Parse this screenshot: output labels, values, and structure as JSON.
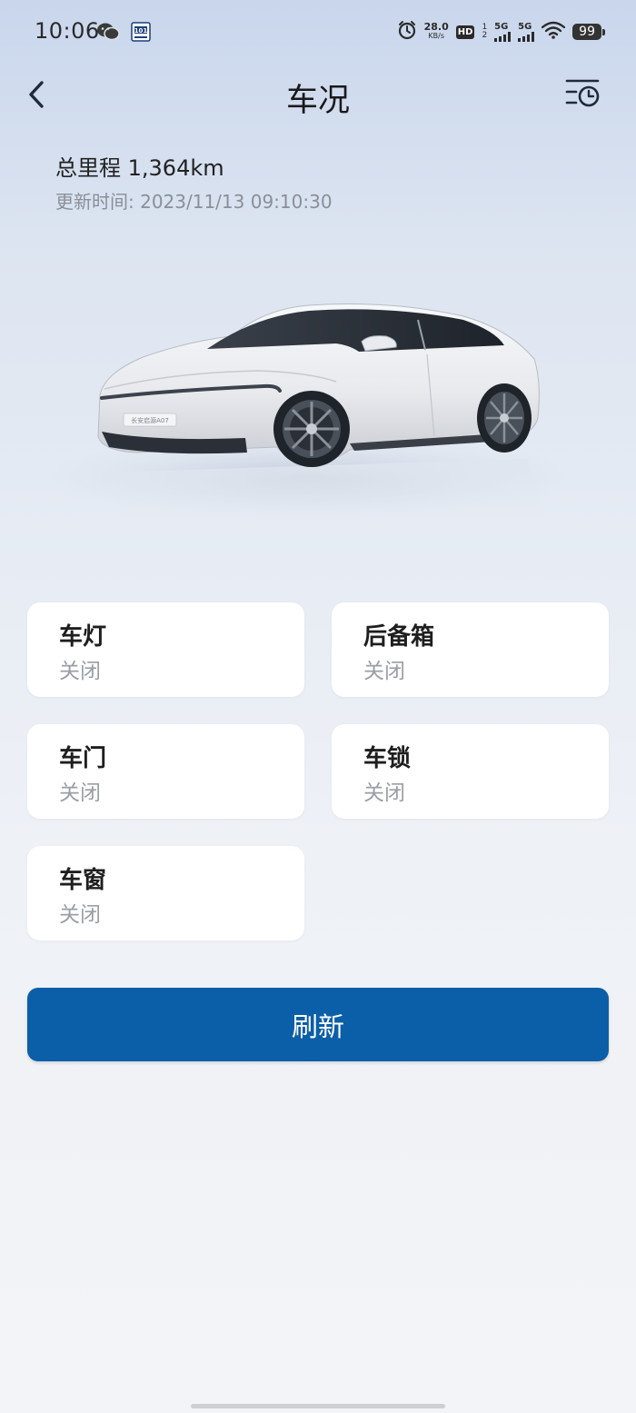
{
  "status_bar": {
    "time": "10:06",
    "net_speed_value": "28.0",
    "net_speed_unit": "KB/s",
    "hd_label": "HD",
    "sim_1": "1",
    "sim_2": "2",
    "signal_1_label": "5G",
    "signal_2_label": "5G",
    "battery": "99",
    "icons": [
      "wechat-icon",
      "app-notification-icon",
      "alarm-icon",
      "wifi-icon"
    ]
  },
  "header": {
    "title": "车况",
    "back_icon": "chevron-left-icon",
    "history_icon": "history-list-icon"
  },
  "vehicle": {
    "mileage": "总里程 1,364km",
    "update_time": "更新时间: 2023/11/13 09:10:30",
    "plate_text": "长安启源A07",
    "colors": {
      "body": "#e9ebef",
      "glass": "#2a2f38"
    }
  },
  "status_cards": [
    {
      "name": "车灯",
      "value": "关闭"
    },
    {
      "name": "后备箱",
      "value": "关闭"
    },
    {
      "name": "车门",
      "value": "关闭"
    },
    {
      "name": "车锁",
      "value": "关闭"
    },
    {
      "name": "车窗",
      "value": "关闭"
    }
  ],
  "refresh_button": {
    "label": "刷新",
    "color": "#0b5ea8"
  },
  "colors": {
    "accent": "#0b5ea8",
    "background_top": "#c9d6ec",
    "background_bottom": "#f3f4f7",
    "secondary_text": "#9a9ea6"
  }
}
